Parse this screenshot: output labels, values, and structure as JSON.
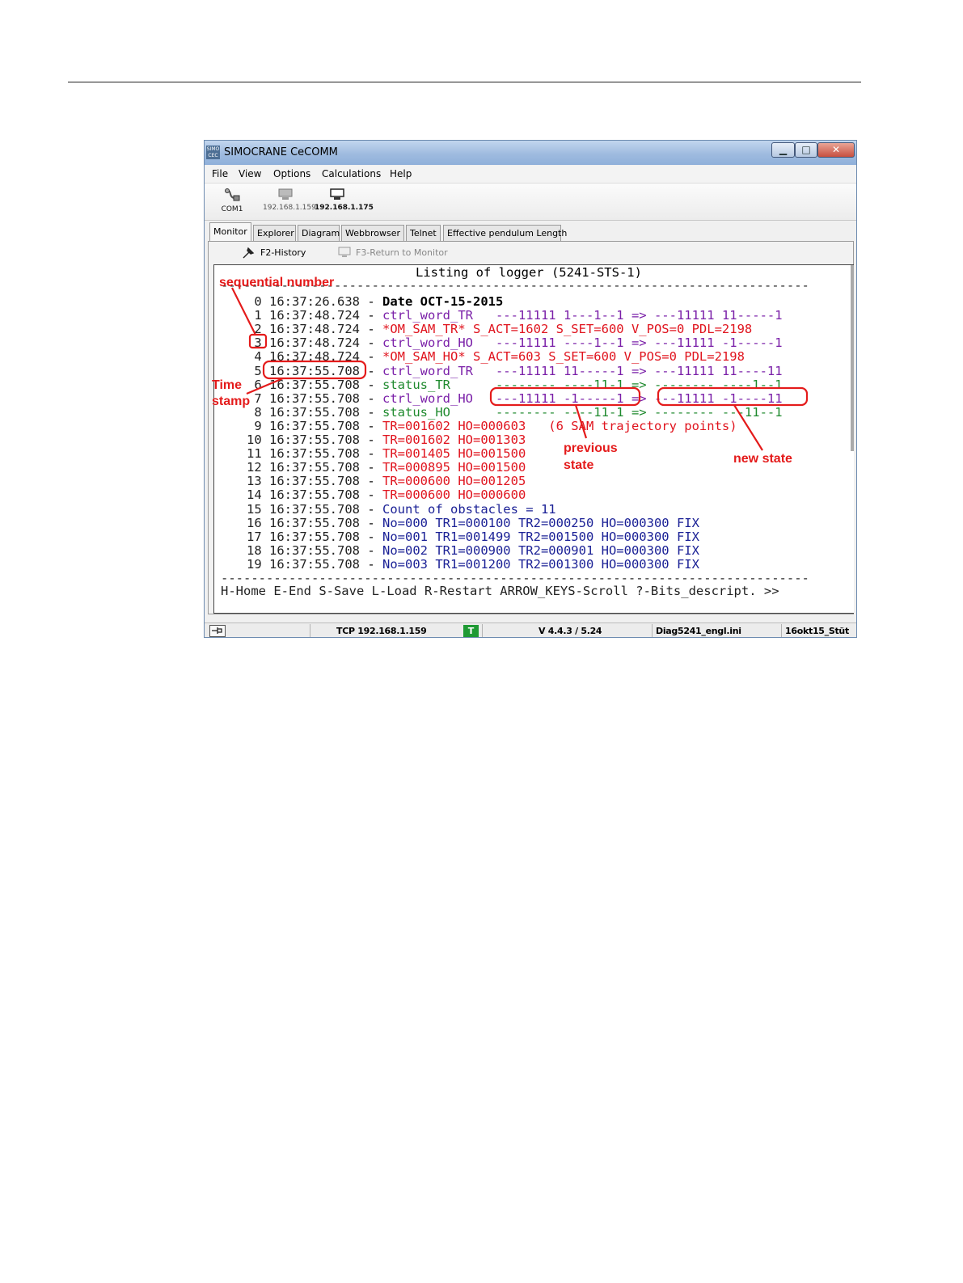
{
  "window": {
    "title": "SIMOCRANE CeCOMM",
    "app_icon": "SIMO\nCEC",
    "controls": {
      "minimize": "▁",
      "maximize": "□",
      "close": "✕"
    }
  },
  "menu": [
    "File",
    "View",
    "Options",
    "Calculations",
    "Help"
  ],
  "toolbar": {
    "items": [
      {
        "label": "COM1",
        "icon": "serial-cable-icon"
      },
      {
        "label": "192.168.1.159",
        "icon": "network-computer-icon"
      },
      {
        "label": "192.168.1.175",
        "icon": "network-computer-icon"
      }
    ]
  },
  "tabs": [
    "Monitor",
    "Explorer",
    "Diagram",
    "Webbrowser",
    "Telnet",
    "Effective pendulum Length"
  ],
  "subtoolbar": {
    "history": "F2-History",
    "return": "F3-Return to Monitor"
  },
  "terminal": {
    "header": "Listing of logger (5241-STS-1)",
    "separator": "------------------------------------------------------------------------------",
    "rows": [
      {
        "n": " 0",
        "t": "16:37:26.638",
        "body": "Date OCT-15-2015",
        "color": "#000000",
        "bold": true
      },
      {
        "n": " 1",
        "t": "16:37:48.724",
        "body": "ctrl_word_TR   ---11111 1---1--1 => ---11111 11-----1",
        "color": "#7a1fa8"
      },
      {
        "n": " 2",
        "t": "16:37:48.724",
        "body": "*OM_SAM_TR* S_ACT=1602 S_SET=600 V_POS=0 PDL=2198",
        "color": "#e0141e"
      },
      {
        "n": " 3",
        "t": "16:37:48.724",
        "body": "ctrl_word_HO   ---11111 ----1--1 => ---11111 -1-----1",
        "color": "#7a1fa8"
      },
      {
        "n": " 4",
        "t": "16:37:48.724",
        "body": "*OM_SAM_HO* S_ACT=603 S_SET=600 V_POS=0 PDL=2198",
        "color": "#e0141e"
      },
      {
        "n": " 5",
        "t": "16:37:55.708",
        "body": "ctrl_word_TR   ---11111 11-----1 => ---11111 11----11",
        "color": "#7a1fa8"
      },
      {
        "n": " 6",
        "t": "16:37:55.708",
        "body": "status_TR      -------- ----11-1 => -------- ----1--1",
        "color": "#1f8a2e"
      },
      {
        "n": " 7",
        "t": "16:37:55.708",
        "body": "ctrl_word_HO   ---11111 -1-----1 => ---11111 -1----11",
        "color": "#7a1fa8"
      },
      {
        "n": " 8",
        "t": "16:37:55.708",
        "body": "status_HO      -------- ----11-1 => -------- ---11--1",
        "color": "#1f8a2e"
      },
      {
        "n": " 9",
        "t": "16:37:55.708",
        "body": "TR=001602 HO=000603   (6 SAM trajectory points)",
        "color": "#e0141e"
      },
      {
        "n": "10",
        "t": "16:37:55.708",
        "body": "TR=001602 HO=001303",
        "color": "#e0141e"
      },
      {
        "n": "11",
        "t": "16:37:55.708",
        "body": "TR=001405 HO=001500",
        "color": "#e0141e"
      },
      {
        "n": "12",
        "t": "16:37:55.708",
        "body": "TR=000895 HO=001500",
        "color": "#e0141e"
      },
      {
        "n": "13",
        "t": "16:37:55.708",
        "body": "TR=000600 HO=001205",
        "color": "#e0141e"
      },
      {
        "n": "14",
        "t": "16:37:55.708",
        "body": "TR=000600 HO=000600",
        "color": "#e0141e"
      },
      {
        "n": "15",
        "t": "16:37:55.708",
        "body": "Count of obstacles = 11",
        "color": "#1b2196"
      },
      {
        "n": "16",
        "t": "16:37:55.708",
        "body": "No=000 TR1=000100 TR2=000250 HO=000300 FIX",
        "color": "#1b2196"
      },
      {
        "n": "17",
        "t": "16:37:55.708",
        "body": "No=001 TR1=001499 TR2=001500 HO=000300 FIX",
        "color": "#1b2196"
      },
      {
        "n": "18",
        "t": "16:37:55.708",
        "body": "No=002 TR1=000900 TR2=000901 HO=000300 FIX",
        "color": "#1b2196"
      },
      {
        "n": "19",
        "t": "16:37:55.708",
        "body": "No=003 TR1=001200 TR2=001300 HO=000300 FIX",
        "color": "#1b2196"
      }
    ],
    "footer": "H-Home E-End S-Save L-Load R-Restart ARROW_KEYS-Scroll ?-Bits_descript. >>"
  },
  "statusbar": {
    "pin_icon": "pin-icon",
    "connection": "TCP 192.168.1.159",
    "badge": "T",
    "version": "V 4.4.3 / 5.24",
    "ini": "Diag5241_engl.ini",
    "date": "16okt15_Stüt"
  },
  "annotations": {
    "sequential": "sequential number",
    "timestamp_1": "Time",
    "timestamp_2": "stamp",
    "previous_1": "previous",
    "previous_2": "state",
    "new_state": "new state",
    "color": "#e41b1b"
  }
}
